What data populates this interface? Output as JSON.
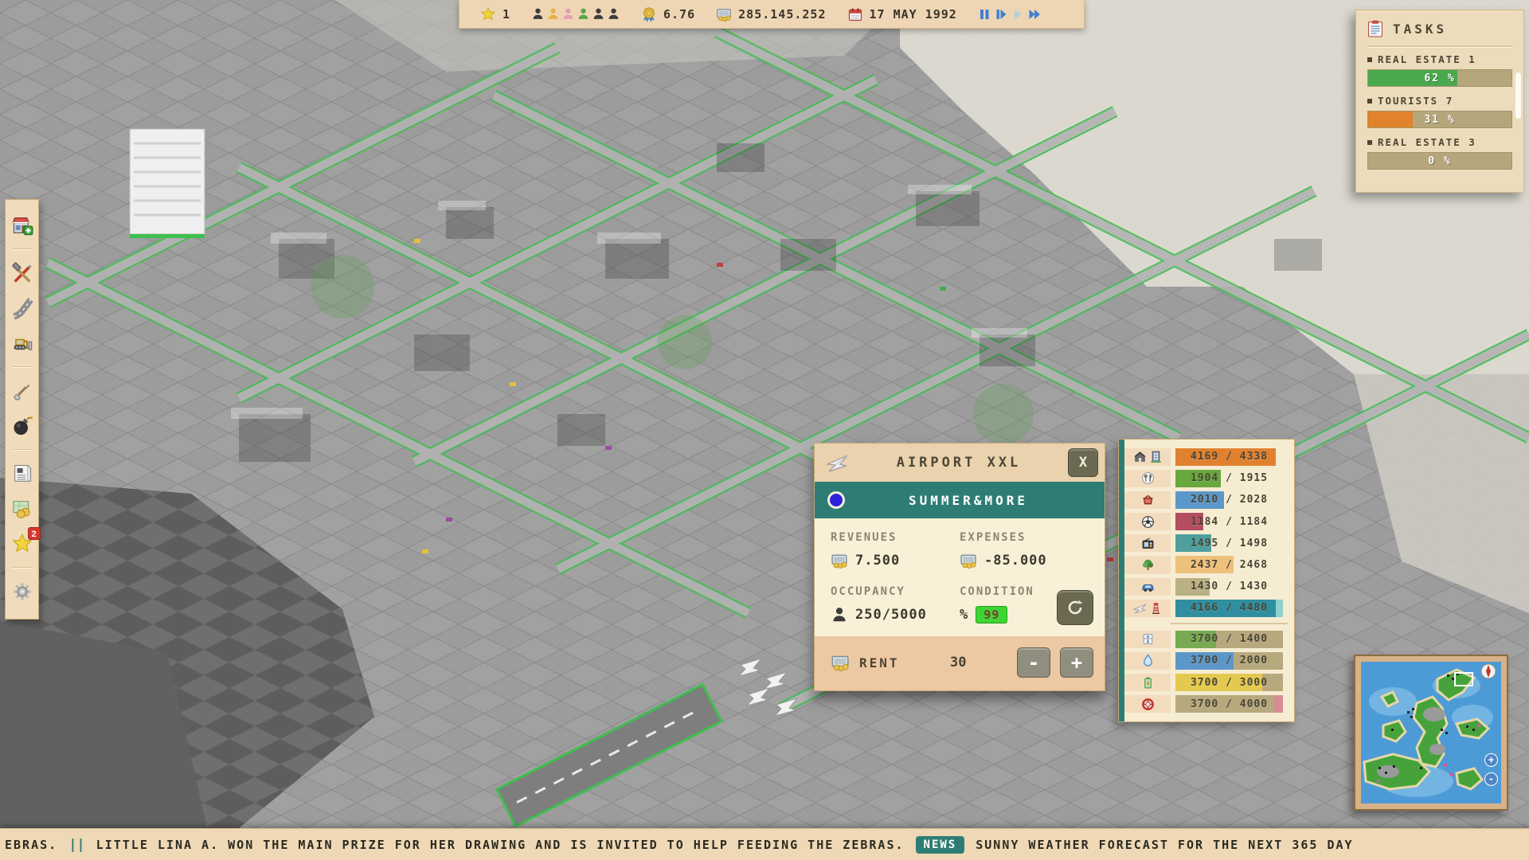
{
  "topbar": {
    "star_count": "1",
    "population": [
      {
        "name": "citizen-dark-1",
        "color": "#3d3d3d"
      },
      {
        "name": "citizen-yellow",
        "color": "#e2b148"
      },
      {
        "name": "citizen-pink",
        "color": "#e2a0b4"
      },
      {
        "name": "citizen-green",
        "color": "#57a54c"
      },
      {
        "name": "citizen-dark-2",
        "color": "#3d3d3d"
      },
      {
        "name": "citizen-dark-3",
        "color": "#3d3d3d"
      }
    ],
    "rating": "6.76",
    "money": "285.145.252",
    "date": "17 MAY 1992",
    "playback": [
      {
        "name": "pause",
        "active": true
      },
      {
        "name": "step",
        "active": true
      },
      {
        "name": "play",
        "active": false
      },
      {
        "name": "fast-forward",
        "active": true
      }
    ]
  },
  "sidebar": {
    "items": [
      {
        "name": "build",
        "icon": "shop"
      },
      {
        "name": "tools",
        "icon": "tools",
        "divider_before": true
      },
      {
        "name": "roads",
        "icon": "road"
      },
      {
        "name": "bulldozer",
        "icon": "bulldozer"
      },
      {
        "name": "terrain",
        "icon": "shovel",
        "divider_before": true
      },
      {
        "name": "demolish",
        "icon": "bomb"
      },
      {
        "name": "newspaper",
        "icon": "news",
        "divider_before": true
      },
      {
        "name": "finances",
        "icon": "map-money"
      },
      {
        "name": "achievements",
        "icon": "star",
        "badge": "2"
      },
      {
        "name": "settings",
        "icon": "gear",
        "divider_before": true
      }
    ]
  },
  "tasks": {
    "title": "TASKS",
    "items": [
      {
        "label": "REAL ESTATE 1",
        "percent": 62,
        "percent_label": "62 %",
        "color": "#4aa94e"
      },
      {
        "label": "TOURISTS 7",
        "percent": 31,
        "percent_label": "31 %",
        "color": "#e0832c"
      },
      {
        "label": "REAL ESTATE 3",
        "percent": 0,
        "percent_label": "0 %",
        "color": "#4aa94e"
      }
    ]
  },
  "dialog": {
    "title": "AIRPORT XXL",
    "close_label": "X",
    "owner": "SUMMER&MORE",
    "revenues_label": "REVENUES",
    "revenues_value": "7.500",
    "expenses_label": "EXPENSES",
    "expenses_value": "-85.000",
    "occupancy_label": "OCCUPANCY",
    "occupancy_value": "250/5000",
    "condition_label": "CONDITION",
    "percent_sign": "%",
    "condition_value": "99",
    "rent_label": "RENT",
    "rent_value": "30",
    "minus_label": "-",
    "plus_label": "+"
  },
  "stats": {
    "track_color": "#b7a97e",
    "rows": [
      {
        "icons": [
          "home",
          "building"
        ],
        "value": "4169 / 4338",
        "segments": [
          {
            "color": "#e0812f",
            "pct": 93
          }
        ]
      },
      {
        "icons": [
          "restaurant"
        ],
        "value": "1904 / 1915",
        "segments": [
          {
            "color": "#69a83d",
            "pct": 42
          }
        ]
      },
      {
        "icons": [
          "shopping"
        ],
        "value": "2010 / 2028",
        "segments": [
          {
            "color": "#5b97c9",
            "pct": 45
          }
        ]
      },
      {
        "icons": [
          "sports"
        ],
        "value": "1184 / 1184",
        "segments": [
          {
            "color": "#b34d60",
            "pct": 26
          }
        ]
      },
      {
        "icons": [
          "media"
        ],
        "value": "1495 / 1498",
        "segments": [
          {
            "color": "#4f9f9f",
            "pct": 33
          }
        ]
      },
      {
        "icons": [
          "park"
        ],
        "value": "2437 / 2468",
        "segments": [
          {
            "color": "#edc07c",
            "pct": 54
          }
        ]
      },
      {
        "icons": [
          "traffic"
        ],
        "value": "1430 / 1430",
        "segments": [
          {
            "color": "#b9b183",
            "pct": 32
          }
        ]
      },
      {
        "icons": [
          "airplane",
          "lighthouse"
        ],
        "value": "4166 / 4480",
        "segments": [
          {
            "color": "#2f8fa0",
            "pct": 93
          },
          {
            "color": "#8ed0cd",
            "pct": 7
          }
        ],
        "divider_after": true
      },
      {
        "icons": [
          "supply"
        ],
        "value": "3700 / 1400",
        "track": true,
        "segments": [
          {
            "color": "#77aa52",
            "pct": 38
          }
        ]
      },
      {
        "icons": [
          "water"
        ],
        "value": "3700 / 2000",
        "track": true,
        "segments": [
          {
            "color": "#5b97c9",
            "pct": 54
          }
        ]
      },
      {
        "icons": [
          "power"
        ],
        "value": "3700 / 3000",
        "track": true,
        "segments": [
          {
            "color": "#e3c94f",
            "pct": 81
          }
        ]
      },
      {
        "icons": [
          "safety"
        ],
        "value": "3700 / 4000",
        "segments": [
          {
            "color": "#b7a97e",
            "pct": 92
          },
          {
            "color": "#d98b95",
            "pct": 8
          }
        ]
      }
    ]
  },
  "minimap": {
    "zoom_in_label": "+",
    "zoom_out_label": "-"
  },
  "ticker": {
    "pre": "EBRAS.",
    "separator": "||",
    "item1": "LITTLE LINA A. WON THE MAIN PRIZE FOR HER DRAWING AND IS INVITED TO HELP FEEDING THE ZEBRAS.",
    "news_badge": "NEWS",
    "item2": "SUNNY WEATHER FORECAST FOR THE NEXT 365 DAY"
  }
}
